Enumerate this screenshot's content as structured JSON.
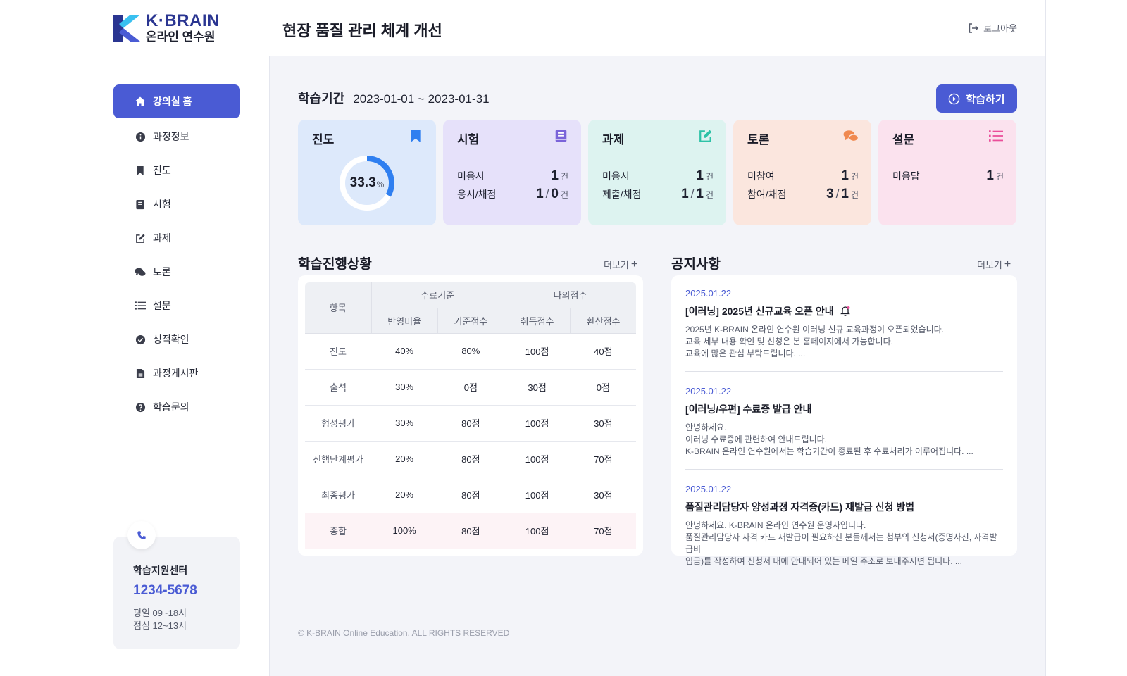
{
  "brand": {
    "name": "K·BRAIN",
    "sub": "온라인 연수원",
    "colors": {
      "primary": "#4a5bd4",
      "logo_dark": "#2a3591",
      "logo_light": "#3ac0f0"
    }
  },
  "header": {
    "title": "현장 품질 관리 체계 개선",
    "logout_label": "로그아웃"
  },
  "sidebar": {
    "items": [
      {
        "label": "강의실 홈",
        "icon": "home-icon",
        "active": true
      },
      {
        "label": "과정정보",
        "icon": "info-icon"
      },
      {
        "label": "진도",
        "icon": "bookmark-icon"
      },
      {
        "label": "시험",
        "icon": "book-icon"
      },
      {
        "label": "과제",
        "icon": "edit-icon"
      },
      {
        "label": "토론",
        "icon": "chat-icon"
      },
      {
        "label": "설문",
        "icon": "list-icon"
      },
      {
        "label": "성적확인",
        "icon": "check-circle-icon"
      },
      {
        "label": "과정게시판",
        "icon": "document-icon"
      },
      {
        "label": "학습문의",
        "icon": "question-icon"
      }
    ],
    "support": {
      "title": "학습지원센터",
      "phone": "1234-5678",
      "hours1": "평일 09~18시",
      "hours2": "점심 12~13시"
    }
  },
  "period": {
    "label": "학습기간",
    "value": "2023-01-01 ~ 2023-01-31"
  },
  "study_button": "학습하기",
  "cards": {
    "progress": {
      "title": "진도",
      "value": "33.3",
      "unit": "%",
      "fraction": 0.333,
      "color": "#dde9fb",
      "accent": "#2f7ff0"
    },
    "exam": {
      "title": "시험",
      "color": "#e6e1fa",
      "accent": "#7a63d9",
      "row1_label": "미응시",
      "row1_value": "1",
      "row2_label": "응시/채점",
      "row2_a": "1",
      "row2_b": "0",
      "unit": "건"
    },
    "assignment": {
      "title": "과제",
      "color": "#ddf3f0",
      "accent": "#2ec2a7",
      "row1_label": "미응시",
      "row1_value": "1",
      "row2_label": "제출/채점",
      "row2_a": "1",
      "row2_b": "1",
      "unit": "건"
    },
    "discussion": {
      "title": "토론",
      "color": "#fbe6de",
      "accent": "#f0894f",
      "row1_label": "미참여",
      "row1_value": "1",
      "row2_label": "참여/채점",
      "row2_a": "3",
      "row2_b": "1",
      "unit": "건"
    },
    "survey": {
      "title": "설문",
      "color": "#fbe2ee",
      "accent": "#ea4f9a",
      "row1_label": "미응답",
      "row1_value": "1",
      "unit": "건"
    }
  },
  "progress_table": {
    "title": "학습진행상황",
    "more": "더보기",
    "headers": {
      "item": "항목",
      "group1": "수료기준",
      "group2": "나의점수",
      "c1": "반영비율",
      "c2": "기준점수",
      "c3": "취득점수",
      "c4": "환산점수"
    },
    "rows": [
      {
        "item": "진도",
        "ratio": "40%",
        "base": "80%",
        "score": "100점",
        "converted": "40점"
      },
      {
        "item": "출석",
        "ratio": "30%",
        "base": "0점",
        "score": "30점",
        "converted": "0점"
      },
      {
        "item": "형성평가",
        "ratio": "30%",
        "base": "80점",
        "score": "100점",
        "converted": "30점"
      },
      {
        "item": "진행단계평가",
        "ratio": "20%",
        "base": "80점",
        "score": "100점",
        "converted": "70점"
      },
      {
        "item": "최종평가",
        "ratio": "20%",
        "base": "80점",
        "score": "100점",
        "converted": "30점"
      },
      {
        "item": "종합",
        "ratio": "100%",
        "base": "80점",
        "score": "100점",
        "converted": "70점"
      }
    ]
  },
  "notices": {
    "title": "공지사항",
    "more": "더보기",
    "items": [
      {
        "date": "2025.01.22",
        "title": "[이러닝] 2025년 신규교육 오픈 안내",
        "line1": "2025년 K-BRAIN 온라인 연수원 이러닝 신규 교육과정이 오픈되었습니다.",
        "line2": "교육 세부 내용 확인 및 신청은 본 홈페이지에서 가능합니다.",
        "line3": "교육에 많은 관심 부탁드립니다. ..."
      },
      {
        "date": "2025.01.22",
        "title": "[이러닝/우편] 수료증 발급 안내",
        "line1": "안녕하세요.",
        "line2": "이러닝 수료증에 관련하여 안내드립니다.",
        "line3": "K-BRAIN 온라인 연수원에서는 학습기간이 종료된 후 수료처리가 이루어집니다. ..."
      },
      {
        "date": "2025.01.22",
        "title": "품질관리담당자 양성과정 자격증(카드) 재발급 신청 방법",
        "line1": "안녕하세요. K-BRAIN 온라인 연수원 운영자입니다.",
        "line2": "품질관리담당자 자격 카드 재발급이 필요하신 분들께서는 첨부의 신청서(증명사진, 자격발급비",
        "line3": "입금)를 작성하여 신청서 내에 안내되어 있는 메일 주소로 보내주시면 됩니다. ..."
      }
    ]
  },
  "footer": "© K-BRAIN Online Education. ALL RIGHTS RESERVED"
}
